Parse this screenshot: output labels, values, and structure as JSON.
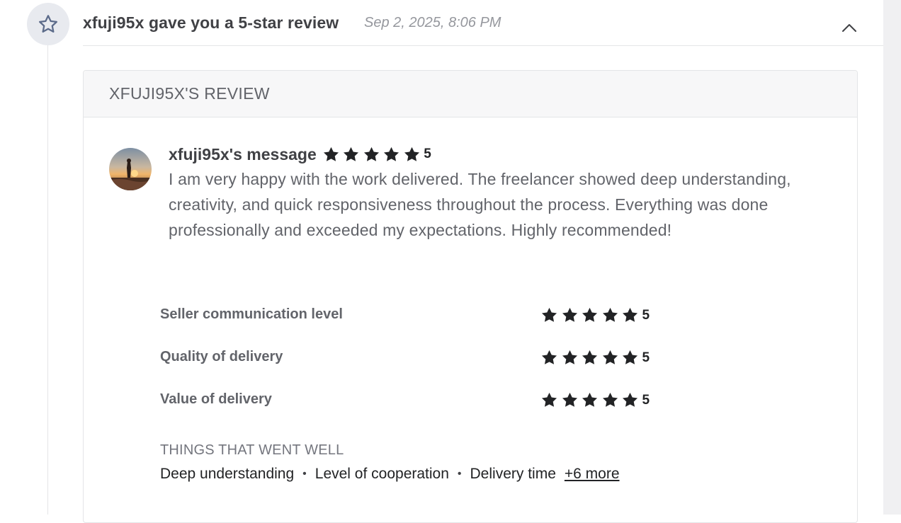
{
  "event": {
    "icon": "star-outline-icon",
    "title": "xfuji95x gave you a 5-star review",
    "date": "Sep 2, 2025, 8:06 PM",
    "toggle_icon": "chevron-up-icon"
  },
  "review": {
    "header": "XFUJI95X'S REVIEW",
    "avatar": "user-avatar",
    "author_label": "xfuji95x's message",
    "overall_rating": "5",
    "overall_stars_filled": 5,
    "message": "I am very happy with the work delivered. The freelancer showed deep understanding, creativity, and quick responsiveness throughout the process. Everything was done professionally and exceeded my expectations. Highly recommended!",
    "criteria": [
      {
        "label": "Seller communication level",
        "rating": "5",
        "stars_filled": 5
      },
      {
        "label": "Quality of delivery",
        "rating": "5",
        "stars_filled": 5
      },
      {
        "label": "Value of delivery",
        "rating": "5",
        "stars_filled": 5
      }
    ],
    "went_well": {
      "title": "THINGS THAT WENT WELL",
      "tags": [
        "Deep understanding",
        "Level of cooperation",
        "Delivery time"
      ],
      "more": "+6 more"
    }
  },
  "colors": {
    "text_dark": "#404145",
    "text_muted": "#62646a",
    "date_gray": "#95979d",
    "star_fill": "#222325",
    "icon_circle_bg": "#e8eaef",
    "card_header_bg": "#f7f7f8",
    "border": "#e4e5e7"
  }
}
